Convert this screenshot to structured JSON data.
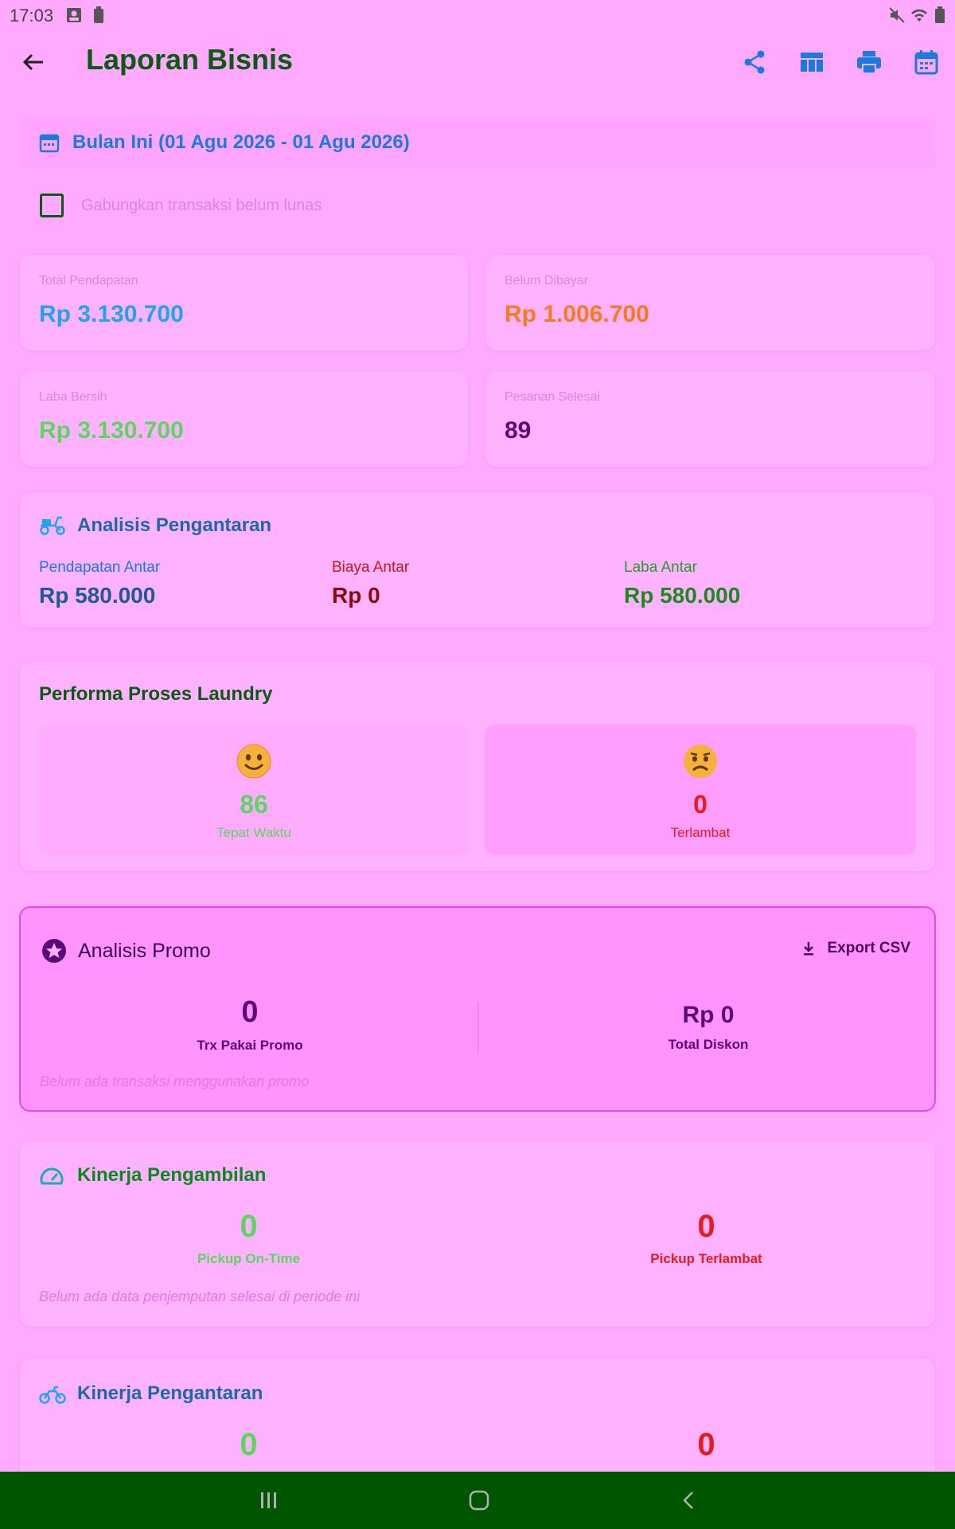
{
  "status_bar": {
    "time": "17:03"
  },
  "app_bar": {
    "title": "Laporan Bisnis",
    "actions": [
      "share-icon",
      "table-icon",
      "print-icon",
      "calendar-icon"
    ]
  },
  "date_range": {
    "label": "Bulan Ini (01 Agu 2026 - 01 Agu 2026)"
  },
  "combine_unpaid": {
    "label": "Gabungkan transaksi belum lunas",
    "checked": false
  },
  "summary": {
    "total_income": {
      "label": "Total Pendapatan",
      "value": "Rp 3.130.700",
      "color": "#1ea4f0"
    },
    "unpaid": {
      "label": "Belum Dibayar",
      "value": "Rp 1.006.700",
      "color": "#f57c1a"
    },
    "net_profit": {
      "label": "Laba Bersih",
      "value": "Rp 3.130.700",
      "color": "#5cd65c"
    },
    "orders_done": {
      "label": "Pesanan Selesai",
      "value": "89",
      "color": "#5a0a7a"
    }
  },
  "delivery_analysis": {
    "title": "Analisis Pengantaran",
    "income": {
      "label": "Pendapatan Antar",
      "value": "Rp 580.000"
    },
    "cost": {
      "label": "Biaya Antar",
      "value": "Rp 0"
    },
    "profit": {
      "label": "Laba Antar",
      "value": "Rp 580.000"
    }
  },
  "laundry_performance": {
    "title": "Performa Proses Laundry",
    "on_time": {
      "value": "86",
      "label": "Tepat Waktu"
    },
    "late": {
      "value": "0",
      "label": "Terlambat"
    }
  },
  "promo_analysis": {
    "title": "Analisis Promo",
    "export_label": "Export CSV",
    "trx_count": {
      "value": "0",
      "label": "Trx Pakai Promo"
    },
    "total_discount": {
      "value": "Rp 0",
      "label": "Total Diskon"
    },
    "empty_note": "Belum ada transaksi menggunakan promo"
  },
  "pickup_performance": {
    "title": "Kinerja Pengambilan",
    "on_time": {
      "value": "0",
      "label": "Pickup On-Time"
    },
    "late": {
      "value": "0",
      "label": "Pickup Terlambat"
    },
    "empty_note": "Belum ada data penjemputan selesai di periode ini"
  },
  "delivery_performance": {
    "title": "Kinerja Pengantaran",
    "on_time": {
      "value": "0"
    },
    "late": {
      "value": "0"
    }
  },
  "colors": {
    "background": "#ffaaff",
    "dark_green": "#0a5a12",
    "blue_accent": "#1a7ae0",
    "navbar": "#005500"
  }
}
